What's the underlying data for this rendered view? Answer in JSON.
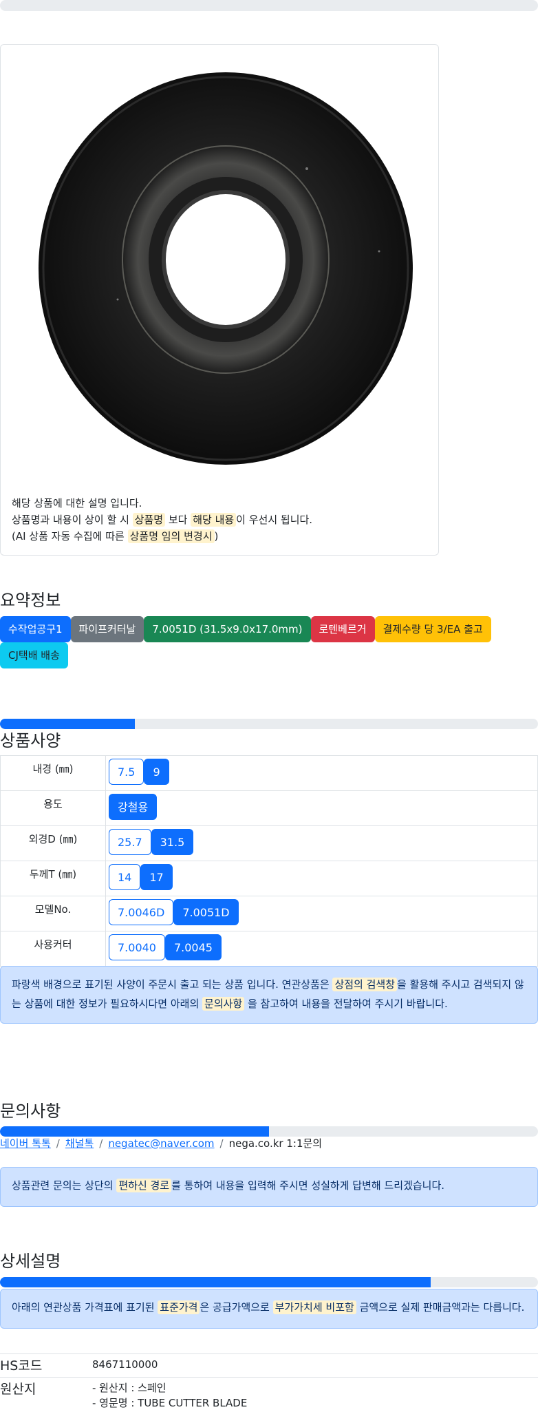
{
  "product": {
    "image_alt": "tube cutter blade",
    "desc_line1": "해당 상품에 대한 설명 입니다.",
    "desc_line2_a": "상품명과 내용이 상이 할 시 ",
    "desc_line2_hl1": "상품명",
    "desc_line2_b": " 보다 ",
    "desc_line2_hl2": "해당 내용",
    "desc_line2_c": "이 우선시 됩니다.",
    "desc_line3_a": "(AI 상품 자동 수집에 따른 ",
    "desc_line3_hl": "상품명 임의 변경시",
    "desc_line3_b": ")"
  },
  "summary": {
    "title": "요약정보",
    "badges": [
      {
        "label": "수작업공구1",
        "color": "#0d6efd",
        "text": "#ffffff"
      },
      {
        "label": "파이프커터날",
        "color": "#6c757d",
        "text": "#ffffff"
      },
      {
        "label": "7.0051D (31.5x9.0x17.0mm)",
        "color": "#198754",
        "text": "#ffffff"
      },
      {
        "label": "로텐베르거",
        "color": "#dc3545",
        "text": "#ffffff"
      },
      {
        "label": "결제수량 당 3/EA 출고",
        "color": "#ffc107",
        "text": "#212529"
      },
      {
        "label": "CJ택배 배송",
        "color": "#0dcaf0",
        "text": "#212529"
      }
    ]
  },
  "spec": {
    "title": "상품사양",
    "progress": 0.25,
    "rows": [
      {
        "key": "내경 (㎜)",
        "options": [
          {
            "v": "7.5",
            "on": false
          },
          {
            "v": "9",
            "on": true
          }
        ]
      },
      {
        "key": "용도",
        "options": [
          {
            "v": "강철용",
            "on": true
          }
        ]
      },
      {
        "key": "외경D (㎜)",
        "options": [
          {
            "v": "25.7",
            "on": false
          },
          {
            "v": "31.5",
            "on": true
          }
        ]
      },
      {
        "key": "두께T (㎜)",
        "options": [
          {
            "v": "14",
            "on": false
          },
          {
            "v": "17",
            "on": true
          }
        ]
      },
      {
        "key": "모델No.",
        "options": [
          {
            "v": "7.0046D",
            "on": false
          },
          {
            "v": "7.0051D",
            "on": true
          }
        ]
      },
      {
        "key": "사용커터",
        "options": [
          {
            "v": "7.0040",
            "on": false
          },
          {
            "v": "7.0045",
            "on": true
          }
        ]
      }
    ],
    "notice_a": "파랑색 배경으로 표기된 사양이 주문시 출고 되는 상품 입니다. 연관상품은 ",
    "notice_hl1": "상점의 검색창",
    "notice_b": "을 활용해 주시고 검색되지 않는 상품에 대한 정보가 필요하시다면 아래의 ",
    "notice_hl2": "문의사항",
    "notice_c": " 을 참고하여 내용을 전달하여 주시기 바랍니다."
  },
  "inquiry": {
    "title": "문의사항",
    "progress": 0.5,
    "links": [
      "네이버 톡톡",
      "채널톡",
      "negatec@naver.com"
    ],
    "plain": "nega.co.kr 1:1문의",
    "separator": "/",
    "notice_a": "상품관련 문의는 상단의 ",
    "notice_hl": "편하신 경로",
    "notice_b": "를 통하여 내용을 입력해 주시면 성실하게 답변해 드리겠습니다."
  },
  "detail": {
    "title": "상세설명",
    "progress": 0.8,
    "notice_a": "아래의 연관상품 가격표에 표기된 ",
    "notice_hl1": "표준가격",
    "notice_b": "은 공급가액으로 ",
    "notice_hl2": "부가가치세 비포함",
    "notice_c": " 금액으로 실제 판매금액과는 다릅니다.",
    "hs_label": "HS코드",
    "hs_value": "8467110000",
    "origin_label": "원산지",
    "origin_line1": "- 원산지 : 스페인",
    "origin_line2": "- 영문명 : TUBE CUTTER BLADE"
  }
}
